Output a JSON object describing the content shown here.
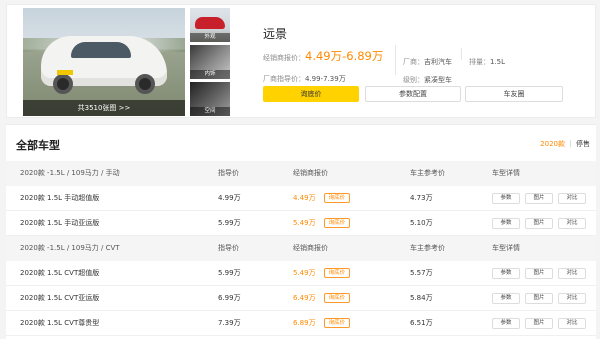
{
  "photos": {
    "count_label": "共3510张图 >>",
    "thumbs": [
      {
        "label": "外观"
      },
      {
        "label": "内饰"
      },
      {
        "label": "空间"
      }
    ]
  },
  "car": {
    "name": "远景",
    "dealer_price_label": "经销商报价：",
    "dealer_price": "4.49万-6.89万",
    "guide_price_label": "厂商指导价：",
    "guide_price": "4.99-7.39万",
    "manufacturer_label": "厂商：",
    "manufacturer": "吉利汽车",
    "level_label": "级别：",
    "level": "紧凑型车",
    "displacement_label": "排量：",
    "displacement": "1.5L"
  },
  "actions": {
    "inquiry": "询底价",
    "config": "参数配置",
    "gallery": "车友圈"
  },
  "list": {
    "title": "全部车型",
    "year_selected": "2020款",
    "stop_sale": "停售",
    "groups": [
      {
        "name": "2020款 -1.5L / 109马力 / 手动",
        "col_guide": "指导价",
        "col_dealer": "经销商报价",
        "col_owner": "车主参考价",
        "col_detail": "车型详情",
        "items": [
          {
            "name": "2020款 1.5L 手动超值版",
            "guide": "4.99万",
            "dealer": "4.49万",
            "owner": "4.73万"
          },
          {
            "name": "2020款 1.5L 手动亚运版",
            "guide": "5.99万",
            "dealer": "5.49万",
            "owner": "5.10万"
          }
        ]
      },
      {
        "name": "2020款 -1.5L / 109马力 / CVT",
        "col_guide": "指导价",
        "col_dealer": "经销商报价",
        "col_owner": "车主参考价",
        "col_detail": "车型详情",
        "items": [
          {
            "name": "2020款 1.5L CVT超值版",
            "guide": "5.99万",
            "dealer": "5.49万",
            "owner": "5.57万"
          },
          {
            "name": "2020款 1.5L CVT亚运版",
            "guide": "6.99万",
            "dealer": "6.49万",
            "owner": "5.84万"
          },
          {
            "name": "2020款 1.5L CVT尊贵型",
            "guide": "7.39万",
            "dealer": "6.89万",
            "owner": "6.51万"
          }
        ]
      }
    ],
    "ask_label": "询底价",
    "btn_params": "参数",
    "btn_photos": "图片",
    "btn_compare": "对比"
  },
  "colors": {
    "accent": "#ff8a00",
    "primary_button": "#ffd200"
  }
}
